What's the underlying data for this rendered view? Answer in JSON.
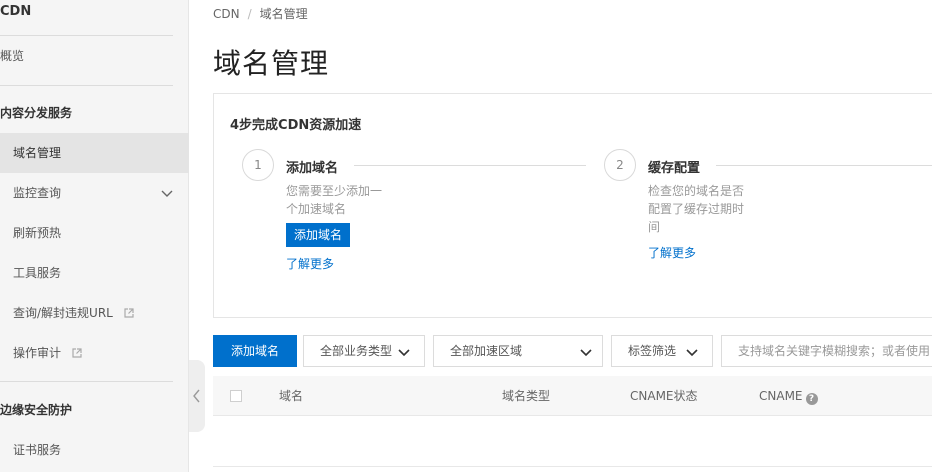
{
  "sidebar": {
    "product_title": "CDN",
    "overview": "概览",
    "section_distribution": "内容分发服务",
    "items": [
      {
        "label": "域名管理"
      },
      {
        "label": "监控查询"
      },
      {
        "label": "刷新预热"
      },
      {
        "label": "工具服务"
      },
      {
        "label": "查询/解封违规URL"
      },
      {
        "label": "操作审计"
      }
    ],
    "section_edge": "边缘安全防护",
    "cert_service": "证书服务"
  },
  "breadcrumb": {
    "root": "CDN",
    "separator": "/",
    "current": "域名管理"
  },
  "page_title": "域名管理",
  "steps": {
    "heading": "4步完成CDN资源加速",
    "step1": {
      "number": "1",
      "title": "添加域名",
      "desc_line1": "您需要至少添加一",
      "desc_line2": "个加速域名",
      "button": "添加域名",
      "link": "了解更多"
    },
    "step2": {
      "number": "2",
      "title": "缓存配置",
      "desc_line1": "检查您的域名是否",
      "desc_line2": "配置了缓存过期时",
      "desc_line3": "间",
      "link": "了解更多"
    }
  },
  "toolbar": {
    "add_button": "添加域名",
    "business_type": "全部业务类型",
    "region": "全部加速区域",
    "tag_filter": "标签筛选",
    "search_placeholder": "支持域名关键字模糊搜索；或者使用"
  },
  "table": {
    "columns": [
      "域名",
      "域名类型",
      "CNAME状态",
      "CNAME"
    ],
    "help_glyph": "?"
  },
  "colors": {
    "primary": "#0070cc",
    "sidebar_bg": "#f5f5f5",
    "sidebar_active": "#e4e4e4"
  }
}
